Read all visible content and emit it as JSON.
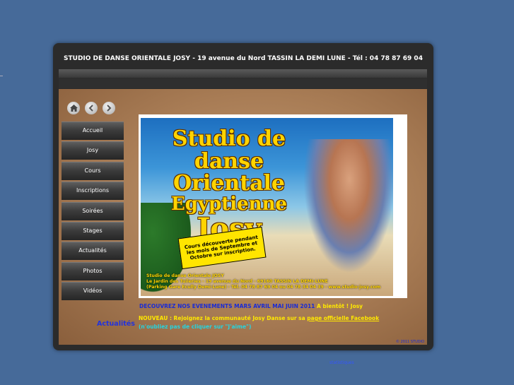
{
  "header": {
    "title": "STUDIO DE DANSE ORIENTALE JOSY - 19 avenue du Nord TASSIN LA DEMI LUNE - Tél : 04 78 87 69 04"
  },
  "toolbar": {
    "icons": [
      "home-icon",
      "back-arrow-icon",
      "forward-arrow-icon"
    ]
  },
  "menu": {
    "items": [
      {
        "label": "Accueil"
      },
      {
        "label": "Josy"
      },
      {
        "label": "Cours"
      },
      {
        "label": "Inscriptions"
      },
      {
        "label": "Soirées"
      },
      {
        "label": "Stages"
      },
      {
        "label": "Actualités"
      },
      {
        "label": "Photos"
      },
      {
        "label": "Vidéos"
      }
    ]
  },
  "banner": {
    "title_1": "Studio de danse",
    "title_2": "Orientale",
    "title_3": "Egyptienne",
    "title_4": "Josy",
    "promo": "Cours découverte pendant les mois de Septembre et Octobre sur inscription.",
    "address_1": "Studio de danse Orientale JOSY",
    "address_2": "Le Jardin des Tuileries - 19 avenue du Nord - 69160 TASSIN LA DEMI-LUNE",
    "address_3": "(Parking Gare Ecully Demi-Lune) - Tél. 04 78 87 69 04 ou 04 78 34 04 39 - www.studio-josy.com"
  },
  "news": {
    "events_text": "DECOUVREZ NOS EVENEMENTS MARS AVRIL MAI JUIN 2011",
    "events_suffix": "A bientôt ! Josy",
    "section_label": "Actualités",
    "new_prefix": "NOUVEAU : Rejoignez la communauté Josy Danse sur sa",
    "facebook_link": "page officielle Facebook",
    "reminder": "(n'oubliez pas de cliquer sur \"J'aime\")"
  },
  "footer": {
    "corner_text": "© 2011 STUDIO",
    "bottom_link": "statistiques"
  }
}
